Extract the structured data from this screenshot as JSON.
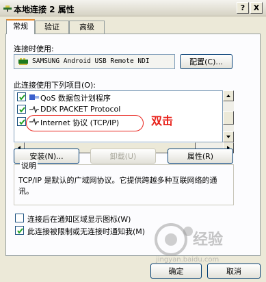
{
  "window": {
    "title": "本地连接 2 属性",
    "help_button": "?",
    "close_button": "X"
  },
  "tabs": [
    {
      "label": "常规"
    },
    {
      "label": "验证"
    },
    {
      "label": "高级"
    }
  ],
  "connect_using": {
    "label": "连接时使用:",
    "device": "SAMSUNG Android USB Remote NDI",
    "configure_button": "配置(C)..."
  },
  "items": {
    "label": "此连接使用下列项目(O):",
    "list": [
      {
        "label": "QoS 数据包计划程序",
        "checked": true,
        "icon": "qos-icon"
      },
      {
        "label": "DDK PACKET Protocol",
        "checked": true,
        "icon": "protocol-icon"
      },
      {
        "label": "Internet 协议 (TCP/IP)",
        "checked": true,
        "icon": "protocol-icon"
      }
    ]
  },
  "buttons": {
    "install": "安装(N)...",
    "uninstall": "卸载(U)",
    "properties": "属性(R)",
    "ok": "确定",
    "cancel": "取消"
  },
  "description": {
    "label": "说明",
    "text": "TCP/IP 是默认的广域网协议。它提供跨越多种互联网络的通讯。"
  },
  "options": [
    {
      "label": "连接后在通知区域显示图标(W)",
      "checked": false
    },
    {
      "label": "此连接被限制或无连接时通知我(M)",
      "checked": true
    }
  ],
  "annotation": {
    "text": "双击"
  },
  "watermark": {
    "text": "经验",
    "url": "jingyan.baidu.com"
  }
}
